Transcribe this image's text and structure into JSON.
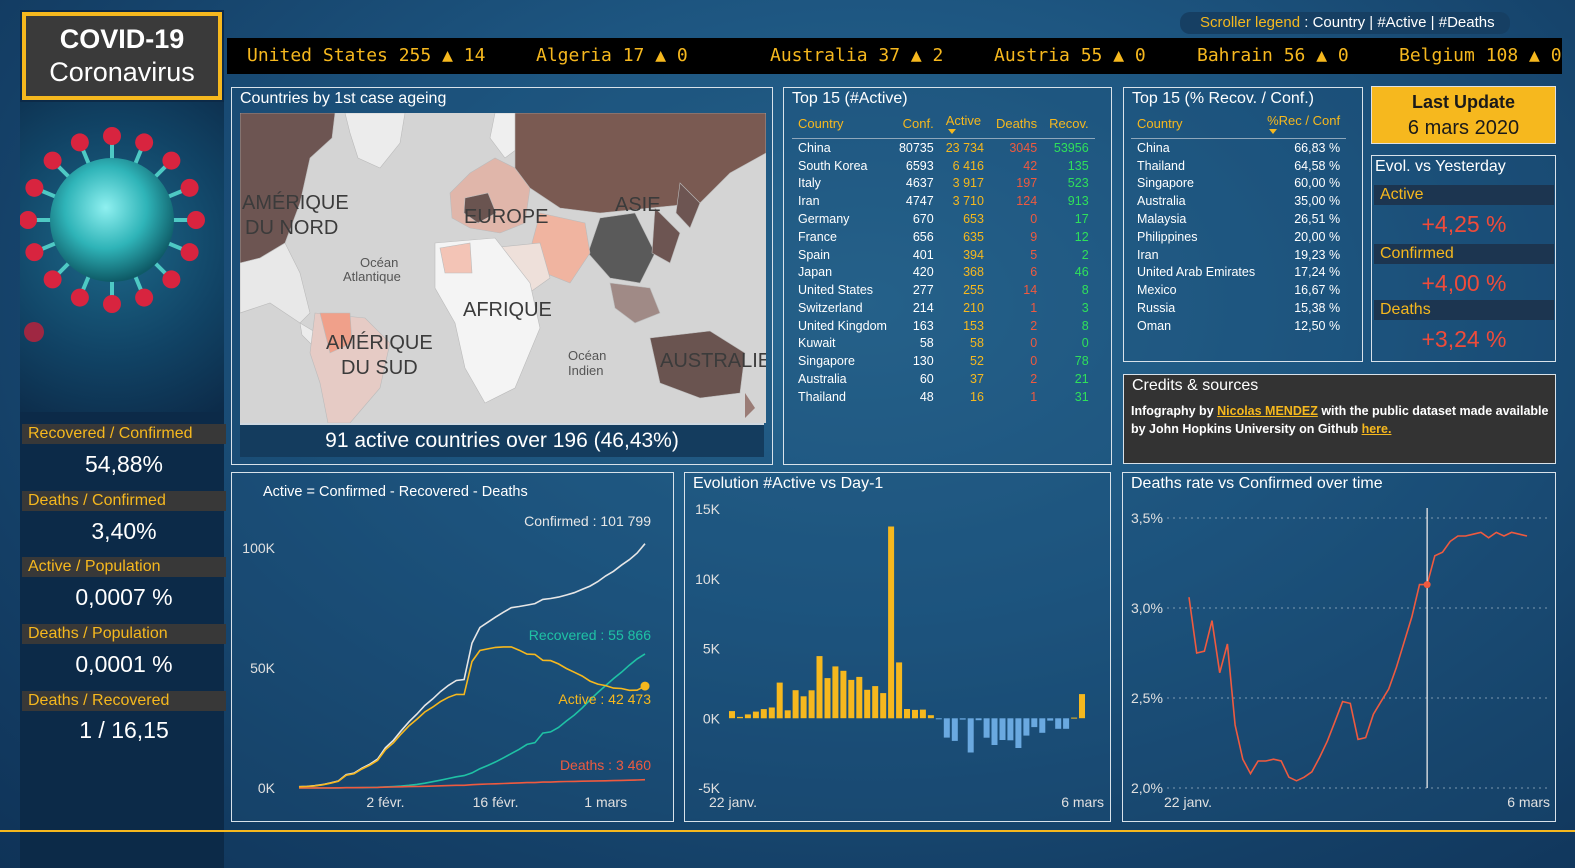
{
  "logo": {
    "line1": "COVID-19",
    "line2": "Coronavirus"
  },
  "sidebar": {
    "kpis": [
      {
        "label": "Recovered / Confirmed",
        "value": "54,88%"
      },
      {
        "label": "Deaths / Confirmed",
        "value": "3,40%"
      },
      {
        "label": "Active / Population",
        "value": "0,0007 %"
      },
      {
        "label": "Deaths / Population",
        "value": "0,0001 %"
      },
      {
        "label": "Deaths / Recovered",
        "value": "1 / 16,15"
      }
    ]
  },
  "scroller": {
    "legend_prefix": "Scroller legend",
    "legend_text": " : Country | #Active | #Deaths",
    "items": [
      "United States 255 ▲ 14",
      "Algeria 17 ▲ 0",
      "Australia 37 ▲ 2",
      "Austria 55 ▲ 0",
      "Bahrain 56 ▲ 0",
      "Belgium 108 ▲ 0"
    ]
  },
  "map_panel": {
    "title": "Countries by 1st case ageing",
    "labels": {
      "north_america": [
        "AMÉRIQUE",
        "DU NORD"
      ],
      "europe": "EUROPE",
      "asia": "ASIE",
      "atlantic": [
        "Océan",
        "Atlantique"
      ],
      "africa": "AFRIQUE",
      "south_america": [
        "AMÉRIQUE",
        "DU SUD"
      ],
      "indian": [
        "Océan",
        "Indien"
      ],
      "australia": "AUSTRALIE"
    },
    "footer": "91 active countries over 196 (46,43%)"
  },
  "top15_active": {
    "title": "Top 15 (#Active)",
    "headers": [
      "Country",
      "Conf.",
      "Active",
      "Deaths",
      "Recov."
    ],
    "rows": [
      [
        "China",
        "80735",
        "23 734",
        "3045",
        "53956"
      ],
      [
        "South Korea",
        "6593",
        "6 416",
        "42",
        "135"
      ],
      [
        "Italy",
        "4637",
        "3 917",
        "197",
        "523"
      ],
      [
        "Iran",
        "4747",
        "3 710",
        "124",
        "913"
      ],
      [
        "Germany",
        "670",
        "653",
        "0",
        "17"
      ],
      [
        "France",
        "656",
        "635",
        "9",
        "12"
      ],
      [
        "Spain",
        "401",
        "394",
        "5",
        "2"
      ],
      [
        "Japan",
        "420",
        "368",
        "6",
        "46"
      ],
      [
        "United States",
        "277",
        "255",
        "14",
        "8"
      ],
      [
        "Switzerland",
        "214",
        "210",
        "1",
        "3"
      ],
      [
        "United Kingdom",
        "163",
        "153",
        "2",
        "8"
      ],
      [
        "Kuwait",
        "58",
        "58",
        "0",
        "0"
      ],
      [
        "Singapore",
        "130",
        "52",
        "0",
        "78"
      ],
      [
        "Australia",
        "60",
        "37",
        "2",
        "21"
      ],
      [
        "Thailand",
        "48",
        "16",
        "1",
        "31"
      ]
    ]
  },
  "top15_recov": {
    "title": "Top 15 (% Recov. / Conf.)",
    "headers": [
      "Country",
      "%Rec / Conf"
    ],
    "rows": [
      [
        "China",
        "66,83 %"
      ],
      [
        "Thailand",
        "64,58 %"
      ],
      [
        "Singapore",
        "60,00 %"
      ],
      [
        "Australia",
        "35,00 %"
      ],
      [
        "Malaysia",
        "26,51 %"
      ],
      [
        "Philippines",
        "20,00 %"
      ],
      [
        "Iran",
        "19,23 %"
      ],
      [
        "United Arab Emirates",
        "17,24 %"
      ],
      [
        "Mexico",
        "16,67 %"
      ],
      [
        "Russia",
        "15,38 %"
      ],
      [
        "Oman",
        "12,50 %"
      ]
    ]
  },
  "last_update": {
    "title": "Last Update",
    "date": "6 mars 2020"
  },
  "evolution": {
    "title": "Evol. vs Yesterday",
    "items": [
      {
        "label": "Active",
        "value": "+4,25 %"
      },
      {
        "label": "Confirmed",
        "value": "+4,00 %"
      },
      {
        "label": "Deaths",
        "value": "+3,24 %"
      }
    ]
  },
  "credits": {
    "title": "Credits & sources",
    "prefix": "Infography by ",
    "author": "Nicolas MENDEZ",
    "middle": " with the public dataset made available by John Hopkins University on Github ",
    "link": "here.",
    "colors": {
      "accent": "#f6b81e",
      "deaths": "#ef5a3f",
      "recovered": "#2fe05a"
    }
  },
  "chart_data": [
    {
      "type": "line",
      "title": "Active = Confirmed - Recovered - Deaths",
      "x": [
        "22 janv.",
        "23 janv.",
        "24 janv.",
        "25 janv.",
        "26 janv.",
        "27 janv.",
        "28 janv.",
        "29 janv.",
        "30 janv.",
        "31 janv.",
        "1 févr.",
        "2 févr.",
        "3 févr.",
        "4 févr.",
        "5 févr.",
        "6 févr.",
        "7 févr.",
        "8 févr.",
        "9 févr.",
        "10 févr.",
        "11 févr.",
        "12 févr.",
        "13 févr.",
        "14 févr.",
        "15 févr.",
        "16 févr.",
        "17 févr.",
        "18 févr.",
        "19 févr.",
        "20 févr.",
        "21 févr.",
        "22 févr.",
        "23 févr.",
        "24 févr.",
        "25 févr.",
        "26 févr.",
        "27 févr.",
        "28 févr.",
        "29 févr.",
        "1 mars",
        "2 mars",
        "3 mars",
        "4 mars",
        "5 mars",
        "6 mars"
      ],
      "xticks": [
        "2 févr.",
        "16 févr.",
        "1 mars"
      ],
      "yticks": [
        "0K",
        "50K",
        "100K"
      ],
      "ylim": [
        0,
        110000
      ],
      "series": [
        {
          "name": "Confirmed",
          "label": "Confirmed : 101 799",
          "color": "#e6e6e6",
          "values": [
            555,
            654,
            941,
            1434,
            2118,
            2927,
            5578,
            6166,
            8234,
            9927,
            12038,
            16787,
            19881,
            23892,
            27635,
            30817,
            34391,
            37120,
            40150,
            42762,
            44802,
            45221,
            60368,
            66885,
            69030,
            71224,
            73258,
            75136,
            75639,
            76197,
            76819,
            78572,
            78958,
            79561,
            80406,
            81388,
            82746,
            84112,
            86011,
            88369,
            90306,
            92840,
            95120,
            97886,
            101799
          ]
        },
        {
          "name": "Recovered",
          "label": "Recovered : 55 866",
          "color": "#1fc2a5",
          "values": [
            28,
            30,
            36,
            39,
            52,
            61,
            107,
            126,
            143,
            222,
            284,
            472,
            623,
            852,
            1124,
            1487,
            2011,
            2616,
            3244,
            3946,
            4683,
            5150,
            6295,
            8058,
            9395,
            10865,
            12583,
            14352,
            16121,
            18177,
            18890,
            22886,
            23394,
            25227,
            27905,
            30384,
            33277,
            36711,
            39782,
            42716,
            45602,
            48228,
            51170,
            53796,
            55866
          ]
        },
        {
          "name": "Deaths",
          "label": "Deaths : 3 460",
          "color": "#ef5a3f",
          "values": [
            17,
            18,
            26,
            42,
            56,
            82,
            131,
            133,
            171,
            213,
            259,
            362,
            426,
            492,
            564,
            634,
            719,
            806,
            906,
            1013,
            1113,
            1118,
            1371,
            1523,
            1666,
            1770,
            1868,
            2007,
            2122,
            2247,
            2251,
            2458,
            2469,
            2629,
            2708,
            2770,
            2814,
            2872,
            2941,
            2996,
            3085,
            3160,
            3254,
            3348,
            3460
          ]
        },
        {
          "name": "Active",
          "label": "Active : 42 473",
          "color": "#f6b81e",
          "values": [
            510,
            606,
            879,
            1353,
            2010,
            2784,
            5340,
            5907,
            7920,
            9492,
            11495,
            15953,
            18832,
            22548,
            25947,
            28696,
            31661,
            33698,
            36000,
            37803,
            39006,
            38953,
            52702,
            57304,
            57969,
            58589,
            58807,
            58777,
            57396,
            55773,
            55678,
            53228,
            53095,
            51705,
            49793,
            48234,
            46655,
            44529,
            43288,
            42657,
            41619,
            41452,
            40696,
            40742,
            42473
          ]
        }
      ]
    },
    {
      "type": "bar",
      "title": "Evolution #Active vs Day-1",
      "x_start": "22 janv.",
      "x_end": "6 mars",
      "yticks": [
        "-5K",
        "0K",
        "5K",
        "10K",
        "15K"
      ],
      "ylim": [
        -5000,
        15000
      ],
      "values": [
        510,
        96,
        273,
        474,
        657,
        774,
        2556,
        567,
        2013,
        1572,
        2003,
        4458,
        2879,
        3716,
        3399,
        2749,
        2965,
        2037,
        2302,
        1803,
        13749,
        4004,
        665,
        602,
        620,
        218,
        -30,
        -1381,
        -1623,
        -95,
        -2450,
        -133,
        -1390,
        -1912,
        -1559,
        -1579,
        -2126,
        -1241,
        -631,
        -1038,
        -167,
        -756,
        -754,
        46,
        1731
      ]
    },
    {
      "type": "line",
      "title": "Deaths rate vs Confirmed over time",
      "x_start": "22 janv.",
      "x_end": "6 mars",
      "yticks": [
        "2,0%",
        "2,5%",
        "3,0%",
        "3,5%"
      ],
      "ylim": [
        2.0,
        3.6
      ],
      "values": [
        3.06,
        2.75,
        2.76,
        2.93,
        2.64,
        2.8,
        2.35,
        2.16,
        2.08,
        2.15,
        2.15,
        2.16,
        2.15,
        2.06,
        2.04,
        2.06,
        2.09,
        2.17,
        2.26,
        2.37,
        2.48,
        2.47,
        2.27,
        2.28,
        2.41,
        2.48,
        2.55,
        2.67,
        2.81,
        2.95,
        3.13,
        3.13,
        3.29,
        3.31,
        3.37,
        3.4,
        3.4,
        3.41,
        3.42,
        3.39,
        3.42,
        3.4,
        3.42,
        3.41,
        3.4
      ]
    }
  ]
}
